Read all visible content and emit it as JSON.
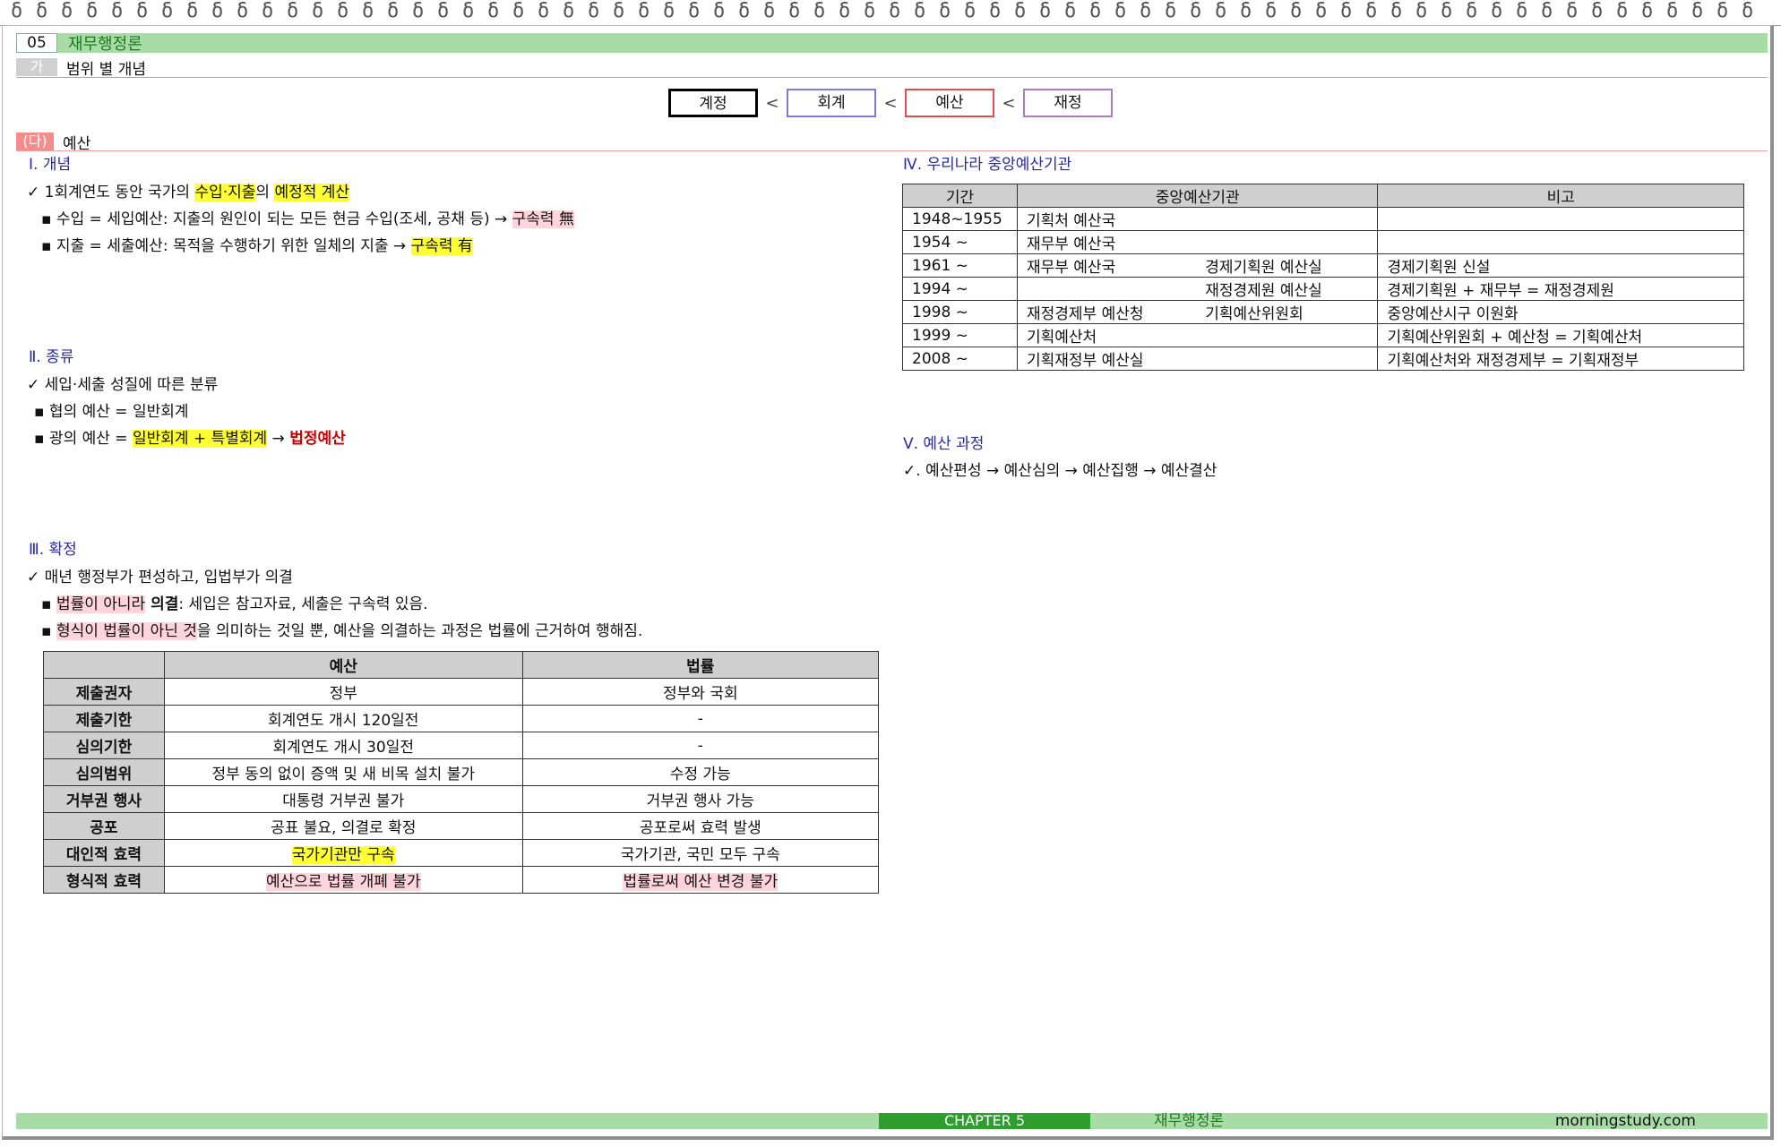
{
  "header": {
    "num": "05",
    "title": "재무행정론"
  },
  "subheader": {
    "num": "가",
    "title": "범위 별 개념"
  },
  "hierarchy": {
    "items": [
      {
        "label": "계정",
        "color": "#000000"
      },
      {
        "label": "회계",
        "color": "#7a7ae0"
      },
      {
        "label": "예산",
        "color": "#e05050"
      },
      {
        "label": "재정",
        "color": "#b07ac0"
      }
    ],
    "sep": "<"
  },
  "section": {
    "tag": "(다)",
    "title": "예산"
  },
  "concept": {
    "heading": "Ⅰ. 개념",
    "line1_pre": "✓ 1회계연도 동안 국가의 ",
    "line1_hl1": "수입·지출",
    "line1_mid": "의 ",
    "line1_hl2": "예정적 계산",
    "line2_pre": "▪ 수입 = 세입예산: 지출의 원인이 되는 모든 현금 수입(조세, 공채 등) → ",
    "line2_hl": "구속력 無",
    "line3_pre": "▪ 지출 = 세출예산: 목적을 수행하기 위한 일체의 지출 → ",
    "line3_hl": "구속력 有"
  },
  "types": {
    "heading": "Ⅱ. 종류",
    "line1": "✓ 세입·세출 성질에 따른 분류",
    "line2": "▪ 협의 예산 = 일반회계",
    "line3_pre": "▪ 광의 예산 = ",
    "line3_hl": "일반회계 + 특별회계",
    "line3_arrow": " → ",
    "line3_red": "법정예산"
  },
  "confirm": {
    "heading": "Ⅲ. 확정",
    "line1": "✓ 매년 행정부가 편성하고, 입법부가 의결",
    "line2_pre": "▪ ",
    "line2_hl": "법률이 아니라",
    "line2_bold": " 의결",
    "line2_post": ": 세입은 참고자료, 세출은 구속력 있음.",
    "line3_pre": "▪ ",
    "line3_hl": "형식이 법률이 아닌 것",
    "line3_post": "을 의미하는 것일 뿐, 예산을 의결하는 과정은 법률에 근거하여 행해짐."
  },
  "compare_table": {
    "headers": [
      "",
      "예산",
      "법률"
    ],
    "rows": [
      [
        "제출권자",
        "정부",
        "정부와 국회"
      ],
      [
        "제출기한",
        "회계연도 개시 120일전",
        "-"
      ],
      [
        "심의기한",
        "회계연도 개시 30일전",
        "-"
      ],
      [
        "심의범위",
        "정부 동의 없이 증액 및 새 비목 설치 불가",
        "수정 가능"
      ],
      [
        "거부권 행사",
        "대통령 거부권 불가",
        "거부권 행사 가능"
      ],
      [
        "공포",
        "공표 불요, 의결로 확정",
        "공포로써 효력 발생"
      ],
      [
        "대인적 효력",
        "국가기관만 구속",
        "국가기관, 국민 모두 구속"
      ],
      [
        "형식적 효력",
        "예산으로 법률 개폐 불가",
        "법률로써 예산 변경 불가"
      ]
    ]
  },
  "agency": {
    "heading": "Ⅳ. 우리나라 중앙예산기관",
    "headers": [
      "기간",
      "중앙예산기관",
      "비고"
    ],
    "rows": [
      [
        "1948~1955",
        "기획처 예산국",
        "",
        ""
      ],
      [
        "1954 ~",
        "재무부 예산국",
        "",
        ""
      ],
      [
        "1961 ~",
        "재무부 예산국",
        "경제기획원 예산실",
        "경제기획원 신설"
      ],
      [
        "1994 ~",
        "",
        "재정경제원 예산실",
        "경제기획원 + 재무부 = 재정경제원"
      ],
      [
        "1998 ~",
        "재정경제부 예산청",
        "기획예산위원회",
        "중앙예산시구 이원화"
      ],
      [
        "1999 ~",
        "기획예산처",
        "",
        "기획예산위원회 + 예산청 = 기획예산처"
      ],
      [
        "2008 ~",
        "기획재정부 예산실",
        "",
        "기획예산처와 재정경제부 = 기획재정부"
      ]
    ]
  },
  "process": {
    "heading": "Ⅴ. 예산 과정",
    "line": "✓. 예산편성 → 예산심의 → 예산집행 → 예산결산"
  },
  "footer": {
    "chapter": "CHAPTER 5",
    "title": "재무행정론",
    "site": "morningstudy.com"
  }
}
